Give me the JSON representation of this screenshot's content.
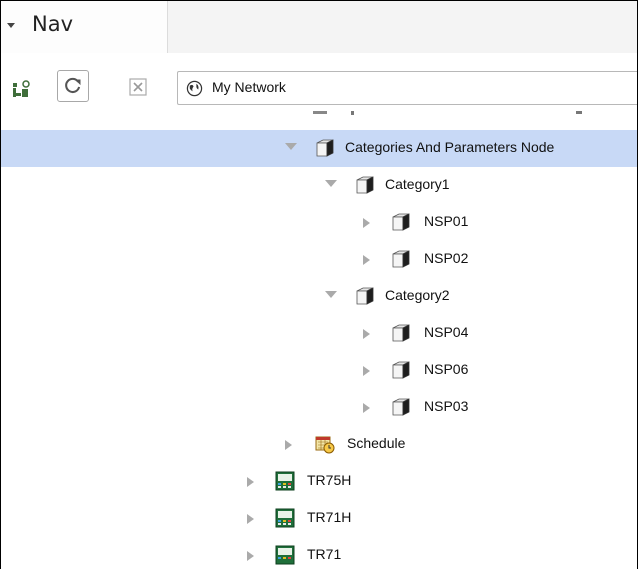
{
  "tab": {
    "title": "Nav",
    "caret_icon": "caret-down-icon"
  },
  "toolbar": {
    "tree_toggle_icon": "tree-view-icon",
    "refresh_icon": "refresh-icon",
    "close_icon": "close-icon",
    "address": {
      "icon": "globe-icon",
      "text": "My Network"
    }
  },
  "tree": {
    "selected_color": "#c8d9f6",
    "items": [
      {
        "label": "Categories And Parameters Node",
        "expanded": true,
        "icon": "cube-icon",
        "selected": true
      },
      {
        "label": "Category1",
        "expanded": true,
        "icon": "cube-icon"
      },
      {
        "label": "NSP01",
        "expanded": false,
        "icon": "cube-icon"
      },
      {
        "label": "NSP02",
        "expanded": false,
        "icon": "cube-icon"
      },
      {
        "label": "Category2",
        "expanded": true,
        "icon": "cube-icon"
      },
      {
        "label": "NSP04",
        "expanded": false,
        "icon": "cube-icon"
      },
      {
        "label": "NSP06",
        "expanded": false,
        "icon": "cube-icon"
      },
      {
        "label": "NSP03",
        "expanded": false,
        "icon": "cube-icon"
      },
      {
        "label": "Schedule",
        "expanded": false,
        "icon": "schedule-icon"
      },
      {
        "label": "TR75H",
        "expanded": false,
        "icon": "device-icon"
      },
      {
        "label": "TR71H",
        "expanded": false,
        "icon": "device-icon"
      },
      {
        "label": "TR71",
        "expanded": false,
        "icon": "device-icon"
      }
    ]
  }
}
